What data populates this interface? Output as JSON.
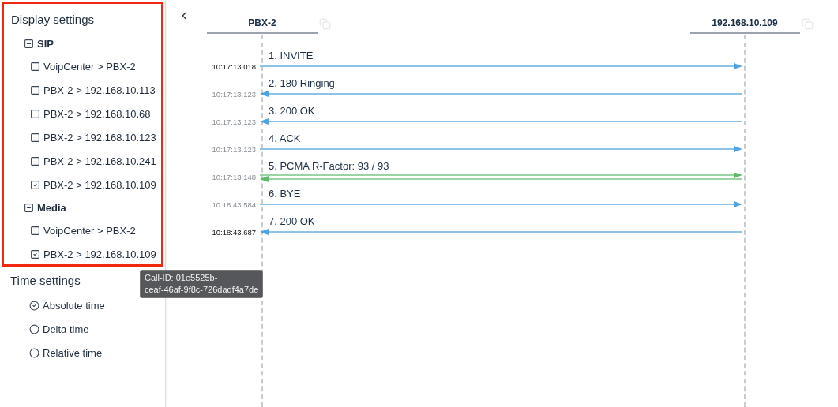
{
  "sidebar": {
    "display_settings": {
      "title": "Display settings",
      "highlighted": true,
      "groups": [
        {
          "label": "SIP",
          "expanded": true,
          "items": [
            {
              "label": "VoipCenter > PBX-2",
              "checked": false
            },
            {
              "label": "PBX-2 > 192.168.10.113",
              "checked": false
            },
            {
              "label": "PBX-2 > 192.168.10.68",
              "checked": false
            },
            {
              "label": "PBX-2 > 192.168.10.123",
              "checked": false
            },
            {
              "label": "PBX-2 > 192.168.10.241",
              "checked": false
            },
            {
              "label": "PBX-2 > 192.168.10.109",
              "checked": true
            }
          ]
        },
        {
          "label": "Media",
          "expanded": true,
          "items": [
            {
              "label": "VoipCenter > PBX-2",
              "checked": false
            },
            {
              "label": "PBX-2 > 192.168.10.109",
              "checked": true
            }
          ]
        }
      ]
    },
    "time_settings": {
      "title": "Time settings",
      "options": [
        {
          "label": "Absolute time",
          "selected": true
        },
        {
          "label": "Delta time",
          "selected": false
        },
        {
          "label": "Relative time",
          "selected": false
        }
      ]
    }
  },
  "tooltip": {
    "lines": [
      "Call-ID: 01e5525b-",
      "ceaf-46af-9f8c-726dadf4a7de"
    ]
  },
  "diagram": {
    "participants": [
      {
        "name": "PBX-2"
      },
      {
        "name": "192.168.10.109"
      }
    ],
    "messages": [
      {
        "label": "1. INVITE",
        "time": "10:17:13.018",
        "time_highlighted": true,
        "to_right": true,
        "to_left": false,
        "kind": "sip"
      },
      {
        "label": "2. 180 Ringing",
        "time": "10:17:13.123",
        "time_highlighted": false,
        "to_right": false,
        "to_left": true,
        "kind": "sip"
      },
      {
        "label": "3. 200 OK",
        "time": "10:17:13.123",
        "time_highlighted": false,
        "to_right": false,
        "to_left": true,
        "kind": "sip"
      },
      {
        "label": "4. ACK",
        "time": "10:17:13.123",
        "time_highlighted": false,
        "to_right": true,
        "to_left": false,
        "kind": "sip"
      },
      {
        "label": "5. PCMA R-Factor: 93 / 93",
        "time": "10:17:13.148",
        "time_highlighted": false,
        "to_right": true,
        "to_left": true,
        "kind": "media"
      },
      {
        "label": "6. BYE",
        "time": "10:18:43.584",
        "time_highlighted": false,
        "to_right": true,
        "to_left": false,
        "kind": "sip"
      },
      {
        "label": "7. 200 OK",
        "time": "10:18:43.687",
        "time_highlighted": true,
        "to_right": false,
        "to_left": true,
        "kind": "sip"
      }
    ]
  }
}
